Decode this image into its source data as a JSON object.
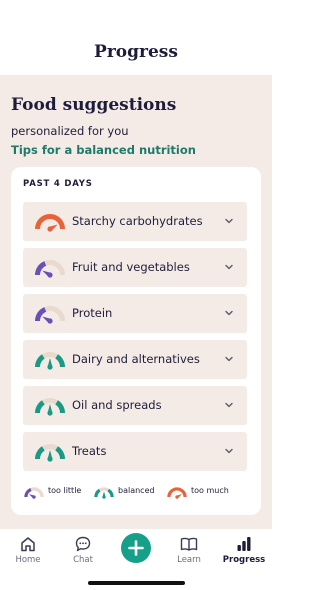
{
  "header": {
    "title": "Progress"
  },
  "main": {
    "title": "Food suggestions",
    "subtitle": "personalized for you",
    "tips_link": "Tips for a balanced nutrition",
    "card": {
      "heading": "PAST 4 DAYS",
      "rows": [
        {
          "label": "Starchy carbohydrates",
          "status": "too much",
          "icon": "gauge-too-much-icon"
        },
        {
          "label": "Fruit and vegetables",
          "status": "too little",
          "icon": "gauge-too-little-icon"
        },
        {
          "label": "Protein",
          "status": "too little",
          "icon": "gauge-too-little-icon"
        },
        {
          "label": "Dairy and alternatives",
          "status": "balanced",
          "icon": "gauge-balanced-icon"
        },
        {
          "label": "Oil and spreads",
          "status": "balanced",
          "icon": "gauge-balanced-icon"
        },
        {
          "label": "Treats",
          "status": "balanced",
          "icon": "gauge-balanced-icon"
        }
      ],
      "legend": [
        {
          "label": "too little",
          "status": "too little"
        },
        {
          "label": "balanced",
          "status": "balanced"
        },
        {
          "label": "too much",
          "status": "too much"
        }
      ]
    }
  },
  "tabbar": {
    "tabs": [
      {
        "label": "Home",
        "icon": "home-icon",
        "active": false
      },
      {
        "label": "Chat",
        "icon": "chat-icon",
        "active": false
      },
      {
        "label": "",
        "icon": "plus-icon",
        "active": false
      },
      {
        "label": "Learn",
        "icon": "book-icon",
        "active": false
      },
      {
        "label": "Progress",
        "icon": "bar-chart-icon",
        "active": true
      }
    ]
  },
  "colors": {
    "too_little": "#6a4fb5",
    "balanced": "#1a9a85",
    "too_much": "#e8633a",
    "track": "#ead9cf",
    "accent": "#16a08a",
    "background": "#f5ebe6",
    "text": "#1d1d3b"
  }
}
